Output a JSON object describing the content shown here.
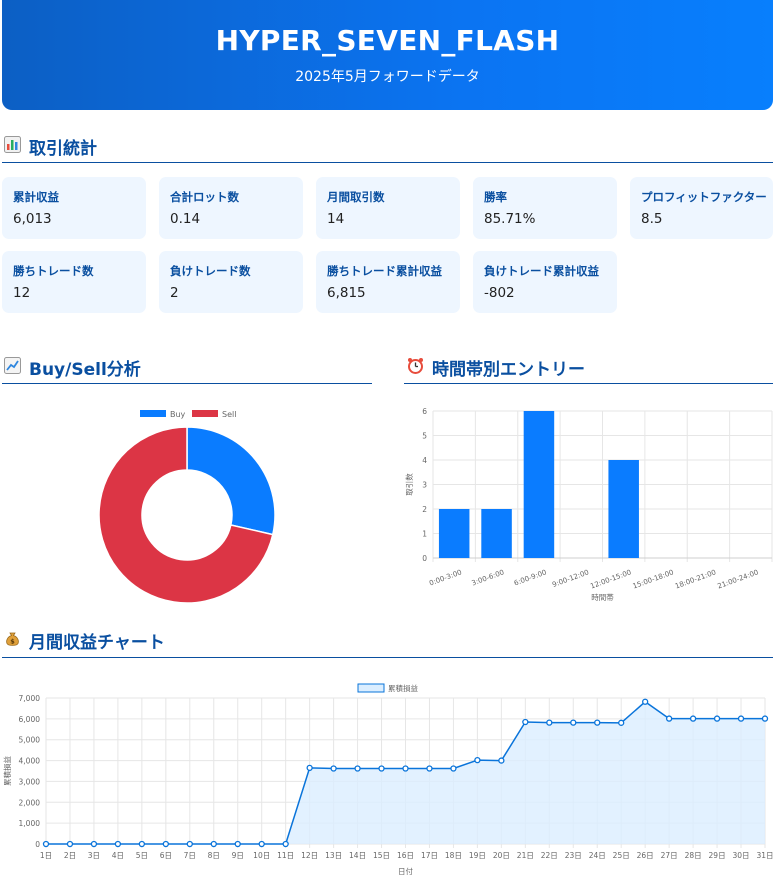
{
  "header": {
    "title": "HYPER_SEVEN_FLASH",
    "subtitle": "2025年5月フォワードデータ"
  },
  "sections": {
    "stats": {
      "icon": "bar-chart-icon",
      "title": "取引統計"
    },
    "buysell": {
      "icon": "trend-chart-icon",
      "title": "Buy/Sell分析"
    },
    "hours": {
      "icon": "alarm-clock-icon",
      "title": "時間帯別エントリー"
    },
    "monthly": {
      "icon": "money-bag-icon",
      "title": "月間収益チャート"
    }
  },
  "stats": [
    {
      "label": "累計収益",
      "value": "6,013"
    },
    {
      "label": "合計ロット数",
      "value": "0.14"
    },
    {
      "label": "月間取引数",
      "value": "14"
    },
    {
      "label": "勝率",
      "value": "85.71%"
    },
    {
      "label": "プロフィットファクター",
      "value": "8.5"
    },
    {
      "label": "勝ちトレード数",
      "value": "12"
    },
    {
      "label": "負けトレード数",
      "value": "2"
    },
    {
      "label": "勝ちトレード累計収益",
      "value": "6,815"
    },
    {
      "label": "負けトレード累計収益",
      "value": "-802"
    }
  ],
  "colors": {
    "blue": "#0a7cff",
    "red": "#dc3545",
    "line": "#0a74da",
    "accent": "#0a4fa0"
  },
  "chart_data": [
    {
      "type": "pie",
      "variant": "doughnut",
      "legend": "top",
      "series": [
        {
          "name": "Buy",
          "value": 4,
          "color": "#0a7cff"
        },
        {
          "name": "Sell",
          "value": 10,
          "color": "#dc3545"
        }
      ]
    },
    {
      "type": "bar",
      "categories": [
        "0:00-3:00",
        "3:00-6:00",
        "6:00-9:00",
        "9:00-12:00",
        "12:00-15:00",
        "15:00-18:00",
        "18:00-21:00",
        "21:00-24:00"
      ],
      "values": [
        2,
        2,
        6,
        0,
        4,
        0,
        0,
        0
      ],
      "xlabel": "時間帯",
      "ylabel": "取引数",
      "ylim": [
        0,
        6
      ],
      "yticks": [
        0,
        1,
        2,
        3,
        4,
        5,
        6
      ],
      "grid": true,
      "color": "#0a7cff"
    },
    {
      "type": "area",
      "legend": "top",
      "series": [
        {
          "name": "累積損益",
          "x": [
            "1日",
            "2日",
            "3日",
            "4日",
            "5日",
            "6日",
            "7日",
            "8日",
            "9日",
            "10日",
            "11日",
            "12日",
            "13日",
            "14日",
            "15日",
            "16日",
            "17日",
            "18日",
            "19日",
            "20日",
            "21日",
            "22日",
            "23日",
            "24日",
            "25日",
            "26日",
            "27日",
            "28日",
            "29日",
            "30日",
            "31日"
          ],
          "values": [
            0,
            0,
            0,
            0,
            0,
            0,
            0,
            0,
            0,
            0,
            0,
            3650,
            3620,
            3620,
            3620,
            3620,
            3620,
            3620,
            4020,
            4000,
            5850,
            5820,
            5820,
            5820,
            5810,
            6820,
            6013,
            6013,
            6013,
            6013,
            6013
          ]
        }
      ],
      "xlabel": "日付",
      "ylabel": "累積損益",
      "ylim": [
        0,
        7000
      ],
      "yticks": [
        0,
        1000,
        2000,
        3000,
        4000,
        5000,
        6000,
        7000
      ],
      "ytick_labels": [
        "0",
        "1,000",
        "2,000",
        "3,000",
        "4,000",
        "5,000",
        "6,000",
        "7,000"
      ],
      "grid": true
    }
  ]
}
